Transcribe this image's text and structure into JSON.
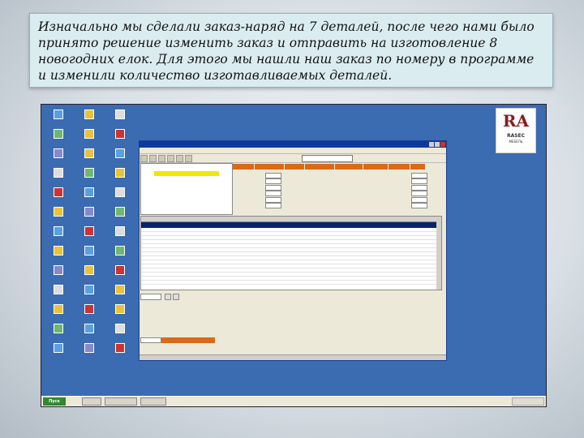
{
  "caption": {
    "text": "Изначально мы сделали заказ-наряд на 7 деталей, после чего нами было принято решение изменить заказ и отправить на изготовление 8 новогодних елок. Для этого мы нашли наш заказ по номеру в программе и изменили количество изготавливаемых деталей."
  },
  "logo": {
    "mark": "RA",
    "line1": "RASEC",
    "line2": "МЕБЕЛЬ"
  },
  "start_button": "Пуск",
  "tray_time": "",
  "colors": {
    "desktop": "#3b6bb0",
    "accent": "#d86a1a",
    "selection": "#0a246a"
  }
}
